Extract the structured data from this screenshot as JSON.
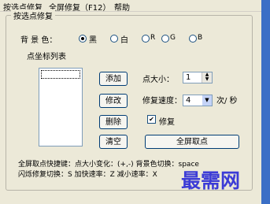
{
  "menu": {
    "items": [
      "按选点修复",
      "全屏修复（F12）",
      "帮助"
    ]
  },
  "group": {
    "title": "按选点修复"
  },
  "background": {
    "label": "背 景 色：",
    "options": [
      {
        "label": "黑",
        "selected": true
      },
      {
        "label": "白",
        "selected": false
      },
      {
        "label": "R",
        "selected": false
      },
      {
        "label": "G",
        "selected": false
      },
      {
        "label": "B",
        "selected": false
      }
    ]
  },
  "list": {
    "label": "点坐标列表"
  },
  "buttons": {
    "add": "添加",
    "edit": "修改",
    "delete": "删除",
    "clear": "清空",
    "fullscreen": "全屏取点"
  },
  "point_size": {
    "label": "点大小：",
    "value": "1"
  },
  "repair_speed": {
    "label": "修复速度：",
    "value": "4",
    "unit": "次/ 秒"
  },
  "repair_checkbox": {
    "label": "修复",
    "checked": true
  },
  "hints": {
    "line1": "全屏取点快捷键：点大小变化：(+,-)  背景色切换：space",
    "line2": "闪烁修复切换：S  加快速率：Z  减小速率：X"
  },
  "watermark": "最需网",
  "colors": {
    "window_bg": "#ece9d8",
    "accent": "#3b6fc6"
  }
}
